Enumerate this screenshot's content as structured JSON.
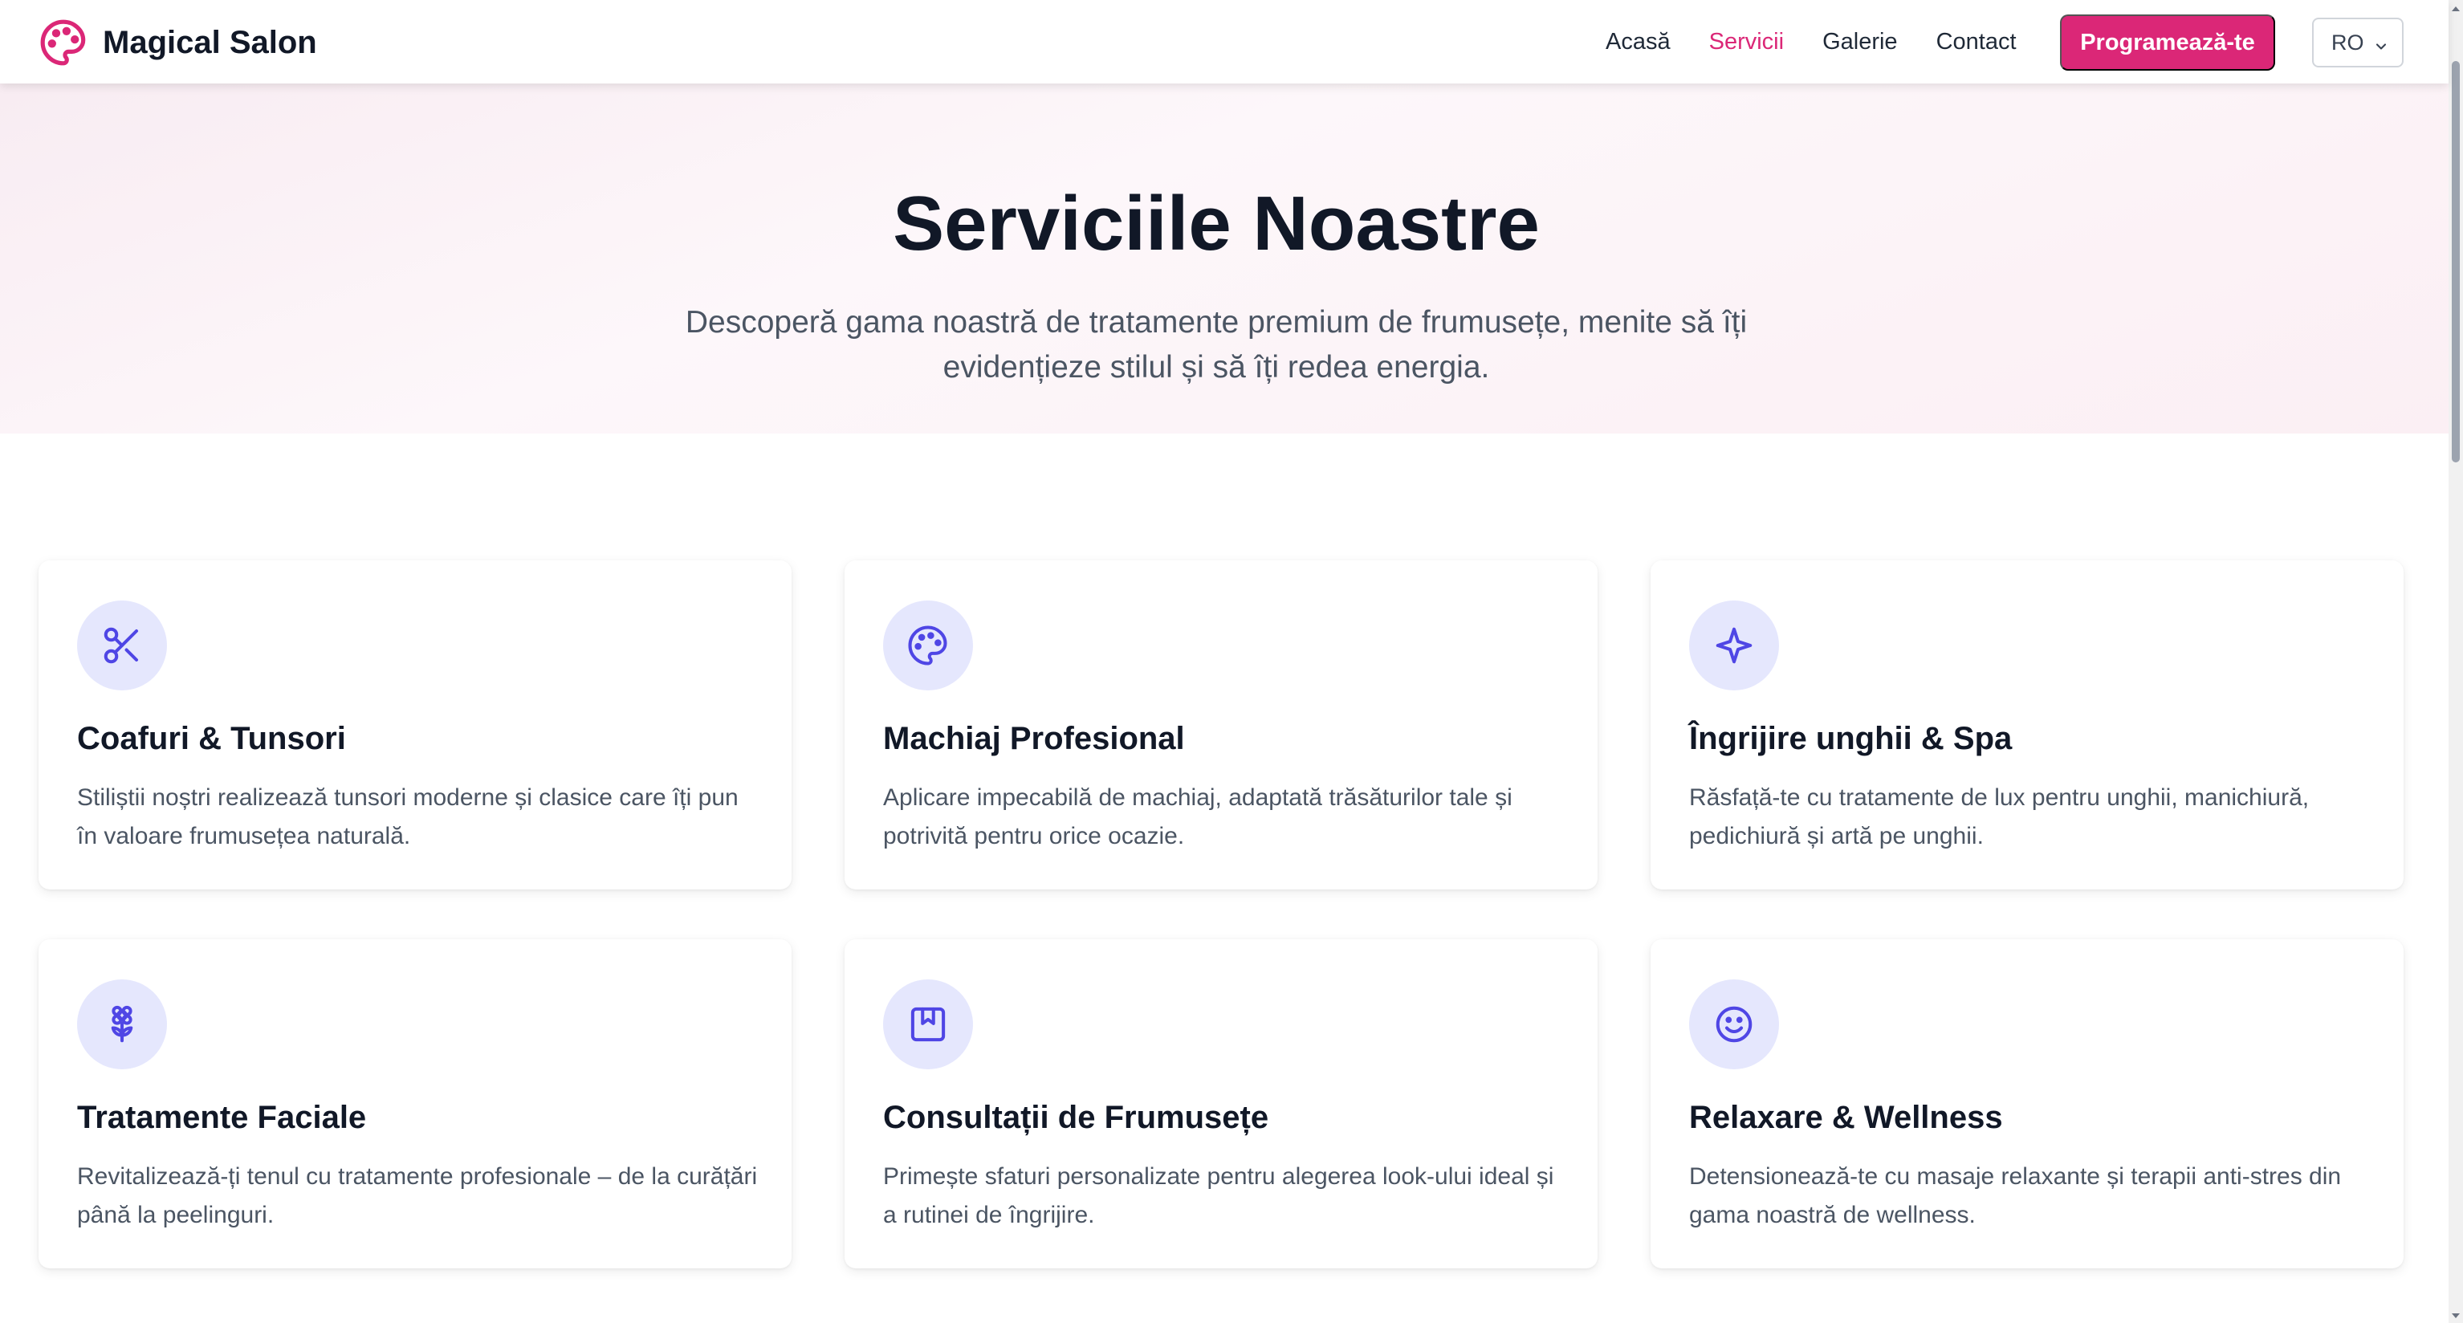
{
  "header": {
    "brand": "Magical Salon",
    "nav": [
      "Acasă",
      "Servicii",
      "Galerie",
      "Contact"
    ],
    "active_nav": "Servicii",
    "cta": "Programează-te",
    "language": "RO",
    "brand_color": "#db2777"
  },
  "hero": {
    "title": "Serviciile Noastre",
    "subtitle": "Descoperă gama noastră de tratamente premium de frumusețe, menite să îți evidențieze stilul și să îți redea energia."
  },
  "services": [
    {
      "icon": "scissors-icon",
      "title": "Coafuri & Tunsori",
      "description": "Stiliștii noștri realizează tunsori moderne și clasice care îți pun în valoare frumusețea naturală."
    },
    {
      "icon": "palette-icon",
      "title": "Machiaj Profesional",
      "description": "Aplicare impecabilă de machiaj, adaptată trăsăturilor tale și potrivită pentru orice ocazie."
    },
    {
      "icon": "sparkle-icon",
      "title": "Îngrijire unghii & Spa",
      "description": "Răsfață-te cu tratamente de lux pentru unghii, manichiură, pedichiură și artă pe unghii."
    },
    {
      "icon": "flower-icon",
      "title": "Tratamente Faciale",
      "description": "Revitalizează-ți tenul cu tratamente profesionale – de la curățări până la peelinguri."
    },
    {
      "icon": "portfolio-icon",
      "title": "Consultații de Frumusețe",
      "description": "Primește sfaturi personalizate pentru alegerea look-ului ideal și a rutinei de îngrijire."
    },
    {
      "icon": "smile-icon",
      "title": "Relaxare & Wellness",
      "description": "Detensionează-te cu masaje relaxante și terapii anti-stres din gama noastră de wellness."
    }
  ],
  "icon_color": "#4f46e5",
  "icon_bg": "#e5e7fd"
}
